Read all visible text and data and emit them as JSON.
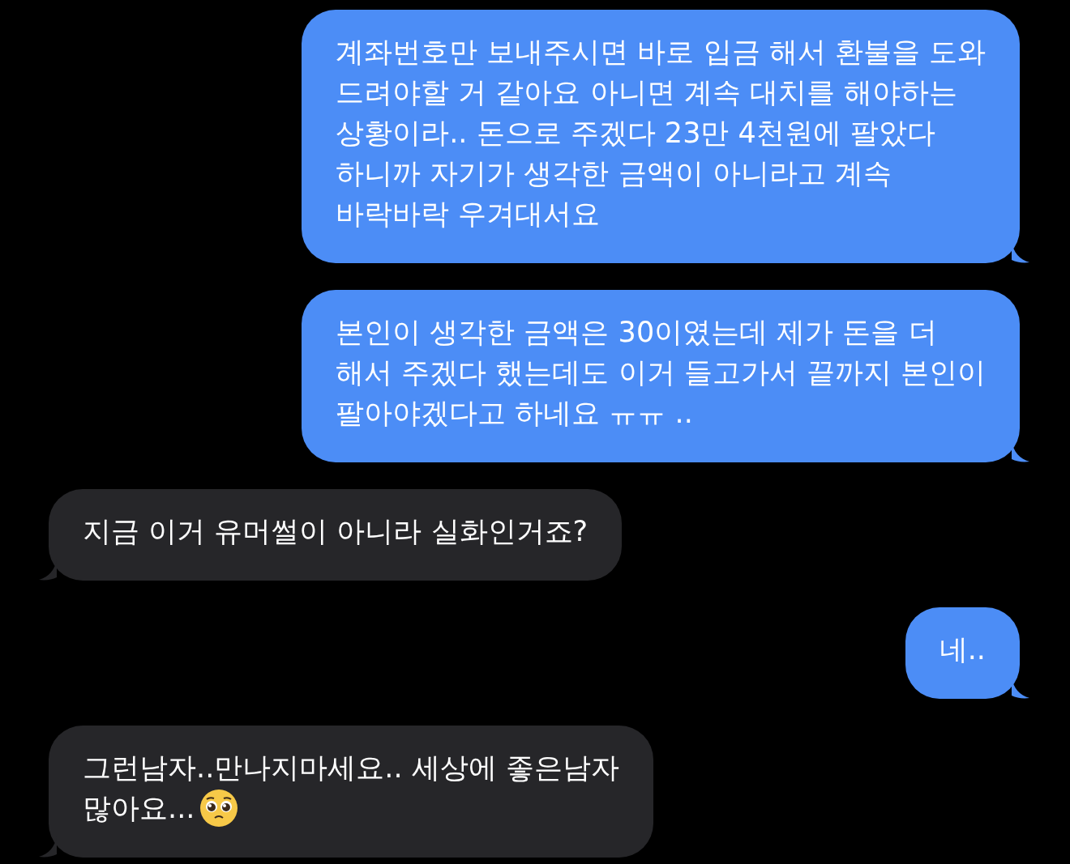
{
  "messages": [
    {
      "kind": "sent",
      "text": "계좌번호만 보내주시면 바로 입금 해서 환불을 도와\n드려야할 거 같아요 아니면 계속 대치를 해야하는\n상황이라.. 돈으로 주겠다 23만 4천원에 팔았다\n하니까 자기가 생각한 금액이 아니라고 계속\n바락바락 우겨대서요"
    },
    {
      "kind": "sent",
      "text": "본인이 생각한 금액은 30이였는데 제가 돈을 더\n해서 주겠다 했는데도 이거 들고가서 끝까지 본인이\n팔아야겠다고 하네요 ㅠㅠ .."
    },
    {
      "kind": "received",
      "text": "지금 이거 유머썰이 아니라 실화인거죠?"
    },
    {
      "kind": "sent",
      "text": "네.."
    },
    {
      "kind": "received",
      "text": "그런남자..만나지마세요.. 세상에 좋은남자",
      "emoji_line": "많아요...",
      "emoji": true
    }
  ]
}
